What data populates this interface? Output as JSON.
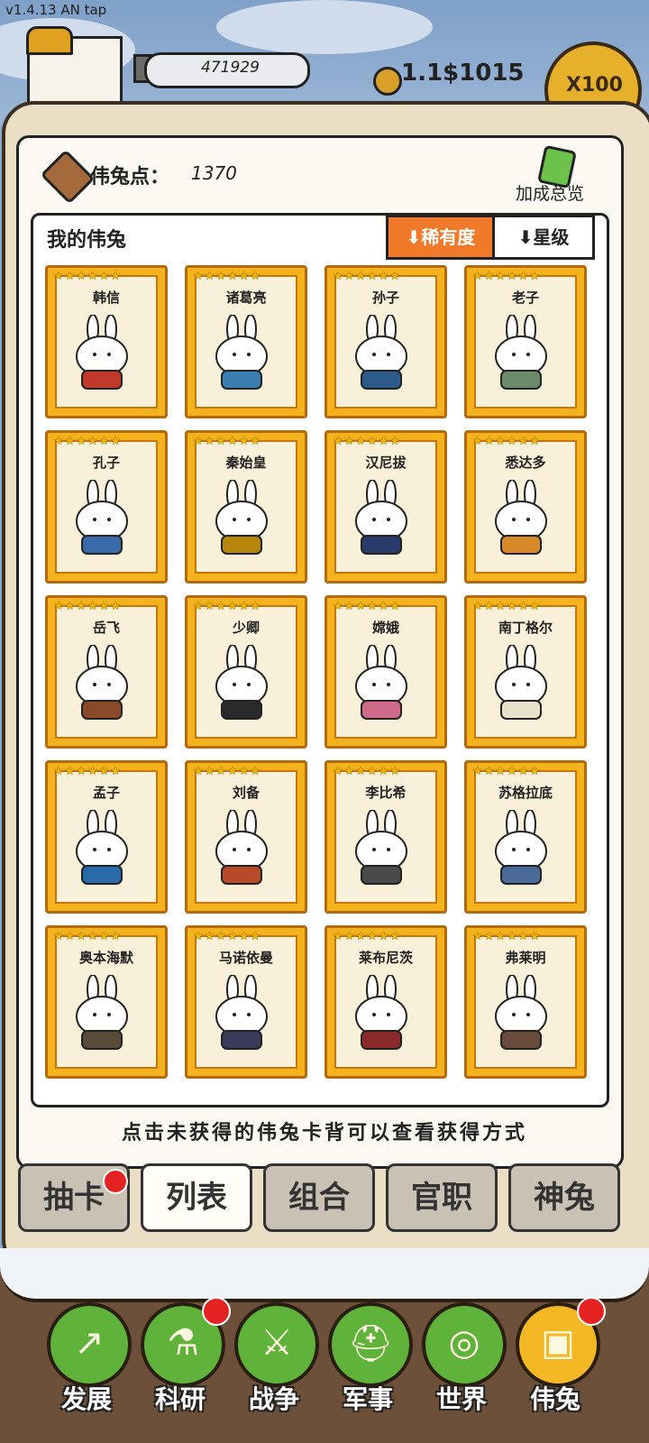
{
  "status": {
    "version": "v1.4.13 AN tap"
  },
  "header": {
    "resource_value": "471929",
    "money": "1.1$1015",
    "multiplier": "X100"
  },
  "points": {
    "label": "伟兔点：",
    "value": "1370",
    "bonus_label": "加成总览"
  },
  "list": {
    "title": "我的伟兔",
    "sort_rarity": "⬇稀有度",
    "sort_star": "⬇星级",
    "stars": "★★★★★★",
    "cards": [
      {
        "name": "韩信"
      },
      {
        "name": "诸葛亮"
      },
      {
        "name": "孙子"
      },
      {
        "name": "老子"
      },
      {
        "name": "孔子"
      },
      {
        "name": "秦始皇"
      },
      {
        "name": "汉尼拔"
      },
      {
        "name": "悉达多"
      },
      {
        "name": "岳飞"
      },
      {
        "name": "少卿"
      },
      {
        "name": "嫦娥"
      },
      {
        "name": "南丁格尔"
      },
      {
        "name": "孟子"
      },
      {
        "name": "刘备"
      },
      {
        "name": "李比希"
      },
      {
        "name": "苏格拉底"
      },
      {
        "name": "奥本海默"
      },
      {
        "name": "马诺依曼"
      },
      {
        "name": "莱布尼茨"
      },
      {
        "name": "弗莱明"
      }
    ]
  },
  "hint": "点击未获得的伟兔卡背可以查看获得方式",
  "tabs": [
    {
      "label": "抽卡",
      "dot": true
    },
    {
      "label": "列表",
      "active": true
    },
    {
      "label": "组合"
    },
    {
      "label": "官职"
    },
    {
      "label": "神兔"
    }
  ],
  "nav": [
    {
      "label": "发展",
      "icon": "develop-icon"
    },
    {
      "label": "科研",
      "icon": "research-icon",
      "dot": true
    },
    {
      "label": "战争",
      "icon": "war-icon"
    },
    {
      "label": "军事",
      "icon": "military-icon"
    },
    {
      "label": "世界",
      "icon": "world-icon"
    },
    {
      "label": "伟兔",
      "icon": "rabbit-icon",
      "dot": true,
      "active": true
    }
  ]
}
